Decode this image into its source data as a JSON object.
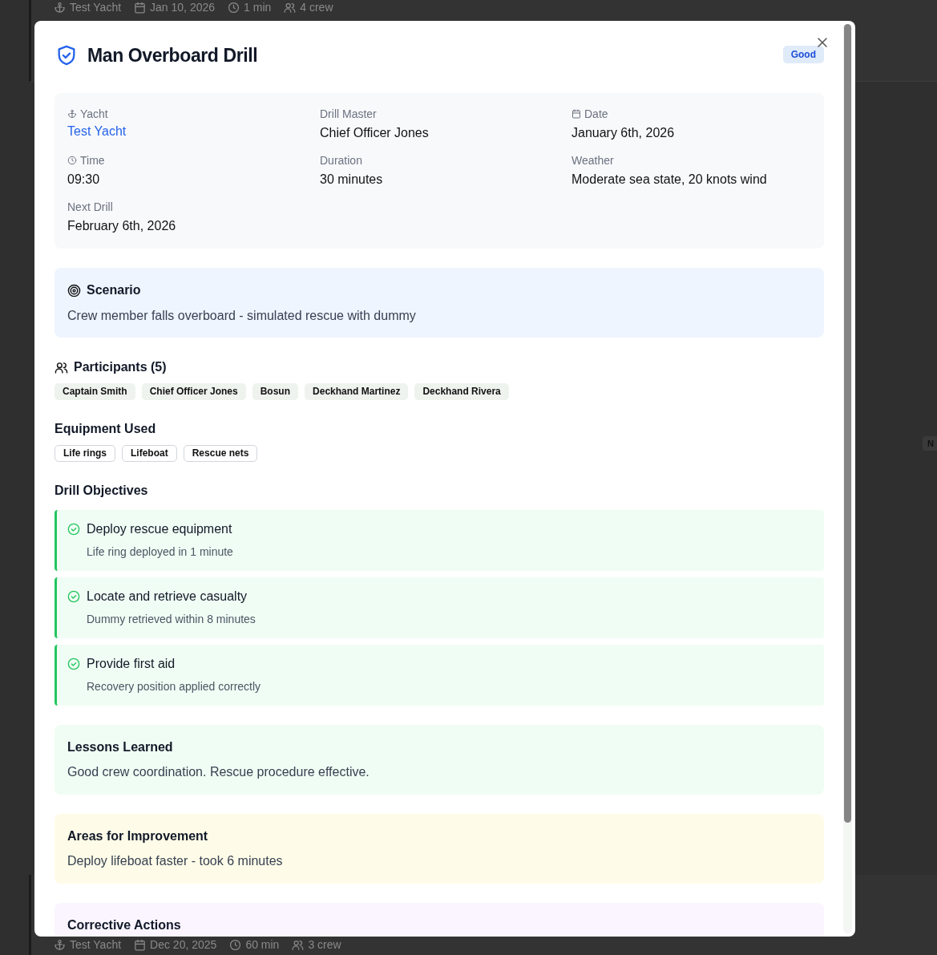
{
  "background": {
    "top_meta": [
      {
        "kind": "anchor",
        "text": "Test Yacht"
      },
      {
        "kind": "calendar",
        "text": "Jan 10, 2026"
      },
      {
        "kind": "clock",
        "text": "1 min"
      },
      {
        "kind": "users",
        "text": "4 crew"
      }
    ],
    "side_badge": "N",
    "bottom_meta": [
      {
        "kind": "anchor",
        "text": "Test Yacht"
      },
      {
        "kind": "calendar",
        "text": "Dec 20, 2025"
      },
      {
        "kind": "clock",
        "text": "60 min"
      },
      {
        "kind": "users",
        "text": "3 crew"
      }
    ]
  },
  "modal": {
    "title": "Man Overboard Drill",
    "rating": "Good",
    "details": [
      {
        "kind": "anchor",
        "label": "Yacht",
        "value": "Test Yacht",
        "link": true
      },
      {
        "kind": "plain",
        "label": "Drill Master",
        "value": "Chief Officer Jones",
        "link": false
      },
      {
        "kind": "calendar",
        "label": "Date",
        "value": "January 6th, 2026",
        "link": false
      },
      {
        "kind": "clock",
        "label": "Time",
        "value": "09:30",
        "link": false
      },
      {
        "kind": "plain",
        "label": "Duration",
        "value": "30 minutes",
        "link": false
      },
      {
        "kind": "plain",
        "label": "Weather",
        "value": "Moderate sea state, 20 knots wind",
        "link": false
      },
      {
        "kind": "plain",
        "label": "Next Drill",
        "value": "February 6th, 2026",
        "link": false
      }
    ],
    "scenario": {
      "title": "Scenario",
      "text": "Crew member falls overboard - simulated rescue with dummy"
    },
    "participants": {
      "title": "Participants (5)",
      "names": [
        "Captain Smith",
        "Chief Officer Jones",
        "Bosun",
        "Deckhand Martinez",
        "Deckhand Rivera"
      ]
    },
    "equipment": {
      "title": "Equipment Used",
      "items": [
        "Life rings",
        "Lifeboat",
        "Rescue nets"
      ]
    },
    "objectives": {
      "title": "Drill Objectives",
      "items": [
        {
          "title": "Deploy rescue equipment",
          "result": "Life ring deployed in 1 minute",
          "achieved": true
        },
        {
          "title": "Locate and retrieve casualty",
          "result": "Dummy retrieved within 8 minutes",
          "achieved": true
        },
        {
          "title": "Provide first aid",
          "result": "Recovery position applied correctly",
          "achieved": true
        }
      ]
    },
    "notes": [
      {
        "kind": "lessons",
        "title": "Lessons Learned",
        "text": "Good crew coordination. Rescue procedure effective."
      },
      {
        "kind": "improvement",
        "title": "Areas for Improvement",
        "text": "Deploy lifeboat faster - took 6 minutes"
      },
      {
        "kind": "corrective",
        "title": "Corrective Actions"
      }
    ]
  }
}
